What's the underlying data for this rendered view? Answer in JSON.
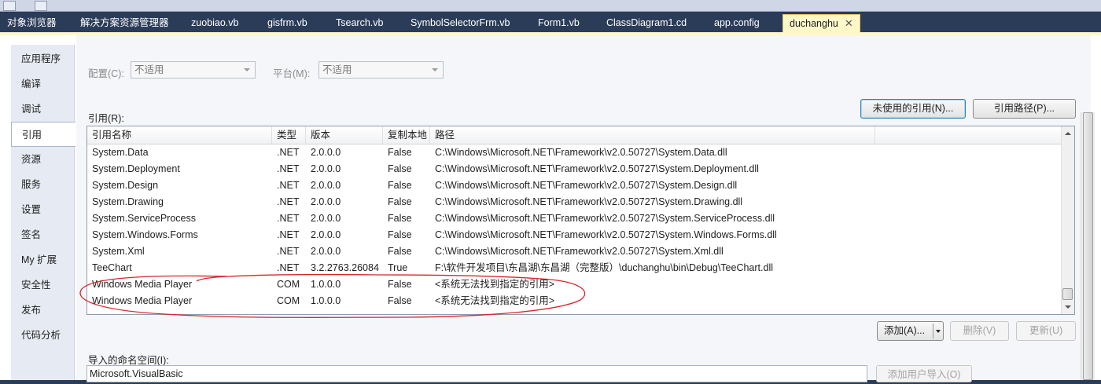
{
  "tabs": [
    {
      "label": "对象浏览器"
    },
    {
      "label": "解决方案资源管理器"
    },
    {
      "label": "zuobiao.vb"
    },
    {
      "label": "gisfrm.vb"
    },
    {
      "label": "Tsearch.vb"
    },
    {
      "label": "SymbolSelectorFrm.vb"
    },
    {
      "label": "Form1.vb"
    },
    {
      "label": "ClassDiagram1.cd"
    },
    {
      "label": "app.config"
    },
    {
      "label": "duchanghu",
      "active": true
    }
  ],
  "sidebar": {
    "items": [
      {
        "label": "应用程序"
      },
      {
        "label": "编译"
      },
      {
        "label": "调试"
      },
      {
        "label": "引用",
        "active": true
      },
      {
        "label": "资源"
      },
      {
        "label": "服务"
      },
      {
        "label": "设置"
      },
      {
        "label": "签名"
      },
      {
        "label": "My 扩展"
      },
      {
        "label": "安全性"
      },
      {
        "label": "发布"
      },
      {
        "label": "代码分析"
      }
    ]
  },
  "config": {
    "config_label": "配置(C):",
    "config_value": "不适用",
    "platform_label": "平台(M):",
    "platform_value": "不适用"
  },
  "references": {
    "label": "引用(R):",
    "unused_button": "未使用的引用(N)...",
    "paths_button": "引用路径(P)...",
    "columns": [
      "引用名称",
      "类型",
      "版本",
      "复制本地",
      "路径"
    ],
    "rows": [
      {
        "name": "System.Data",
        "type": ".NET",
        "version": "2.0.0.0",
        "copy": "False",
        "path": "C:\\Windows\\Microsoft.NET\\Framework\\v2.0.50727\\System.Data.dll"
      },
      {
        "name": "System.Deployment",
        "type": ".NET",
        "version": "2.0.0.0",
        "copy": "False",
        "path": "C:\\Windows\\Microsoft.NET\\Framework\\v2.0.50727\\System.Deployment.dll"
      },
      {
        "name": "System.Design",
        "type": ".NET",
        "version": "2.0.0.0",
        "copy": "False",
        "path": "C:\\Windows\\Microsoft.NET\\Framework\\v2.0.50727\\System.Design.dll"
      },
      {
        "name": "System.Drawing",
        "type": ".NET",
        "version": "2.0.0.0",
        "copy": "False",
        "path": "C:\\Windows\\Microsoft.NET\\Framework\\v2.0.50727\\System.Drawing.dll"
      },
      {
        "name": "System.ServiceProcess",
        "type": ".NET",
        "version": "2.0.0.0",
        "copy": "False",
        "path": "C:\\Windows\\Microsoft.NET\\Framework\\v2.0.50727\\System.ServiceProcess.dll"
      },
      {
        "name": "System.Windows.Forms",
        "type": ".NET",
        "version": "2.0.0.0",
        "copy": "False",
        "path": "C:\\Windows\\Microsoft.NET\\Framework\\v2.0.50727\\System.Windows.Forms.dll"
      },
      {
        "name": "System.Xml",
        "type": ".NET",
        "version": "2.0.0.0",
        "copy": "False",
        "path": "C:\\Windows\\Microsoft.NET\\Framework\\v2.0.50727\\System.Xml.dll"
      },
      {
        "name": "TeeChart",
        "type": ".NET",
        "version": "3.2.2763.26084",
        "copy": "True",
        "path": "F:\\软件开发项目\\东昌湖\\东昌湖（完整版）\\duchanghu\\bin\\Debug\\TeeChart.dll"
      },
      {
        "name": "Windows Media Player",
        "type": "COM",
        "version": "1.0.0.0",
        "copy": "False",
        "path": "<系统无法找到指定的引用>"
      },
      {
        "name": "Windows Media Player",
        "type": "COM",
        "version": "1.0.0.0",
        "copy": "False",
        "path": "<系统无法找到指定的引用>"
      }
    ]
  },
  "actions": {
    "add_button": "添加(A)...",
    "remove_button": "删除(V)",
    "update_button": "更新(U)"
  },
  "namespaces": {
    "label": "导入的命名空间(I):",
    "value": "Microsoft.VisualBasic",
    "add_user_import_button": "添加用户导入(O)"
  },
  "colors": {
    "tab_bar": "#2b3c59",
    "active_tab": "#fff7c8",
    "annotation": "#d9262b"
  },
  "icons": [
    "toolbar-icon",
    "close-icon",
    "chevron-down-icon",
    "scroll-up-icon",
    "scroll-down-icon"
  ]
}
